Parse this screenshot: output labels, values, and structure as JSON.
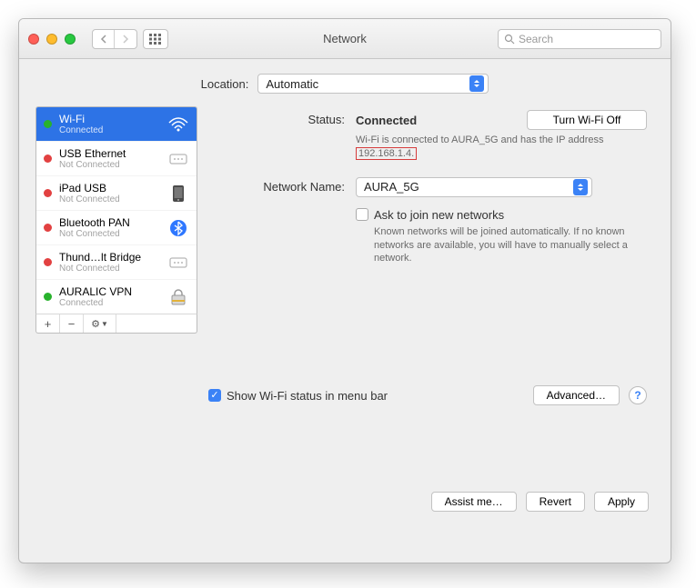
{
  "window": {
    "title": "Network"
  },
  "toolbar": {
    "search_placeholder": "Search"
  },
  "location": {
    "label": "Location:",
    "value": "Automatic"
  },
  "sidebar": {
    "items": [
      {
        "name": "Wi-Fi",
        "sub": "Connected",
        "status": "green",
        "icon": "wifi",
        "selected": true
      },
      {
        "name": "USB Ethernet",
        "sub": "Not Connected",
        "status": "red",
        "icon": "ethernet",
        "selected": false
      },
      {
        "name": "iPad USB",
        "sub": "Not Connected",
        "status": "red",
        "icon": "device",
        "selected": false
      },
      {
        "name": "Bluetooth PAN",
        "sub": "Not Connected",
        "status": "red",
        "icon": "bluetooth",
        "selected": false
      },
      {
        "name": "Thund…lt Bridge",
        "sub": "Not Connected",
        "status": "red",
        "icon": "ethernet",
        "selected": false
      },
      {
        "name": "AURALIC VPN",
        "sub": "Connected",
        "status": "green",
        "icon": "lock",
        "selected": false
      }
    ],
    "footer": {
      "add": "+",
      "remove": "−",
      "gear": "⚙︎▾"
    }
  },
  "detail": {
    "status_label": "Status:",
    "status_value": "Connected",
    "wifi_off_btn": "Turn Wi-Fi Off",
    "status_desc_pre": "Wi-Fi is connected to AURA_5G and has the IP address ",
    "status_desc_ip": "192.168.1.4.",
    "network_name_label": "Network Name:",
    "network_name_value": "AURA_5G",
    "ask_join_label": "Ask to join new networks",
    "ask_join_desc": "Known networks will be joined automatically. If no known networks are available, you will have to manually select a network.",
    "show_menu_bar": "Show Wi-Fi status in menu bar",
    "advanced_btn": "Advanced…"
  },
  "actions": {
    "assist": "Assist me…",
    "revert": "Revert",
    "apply": "Apply"
  }
}
